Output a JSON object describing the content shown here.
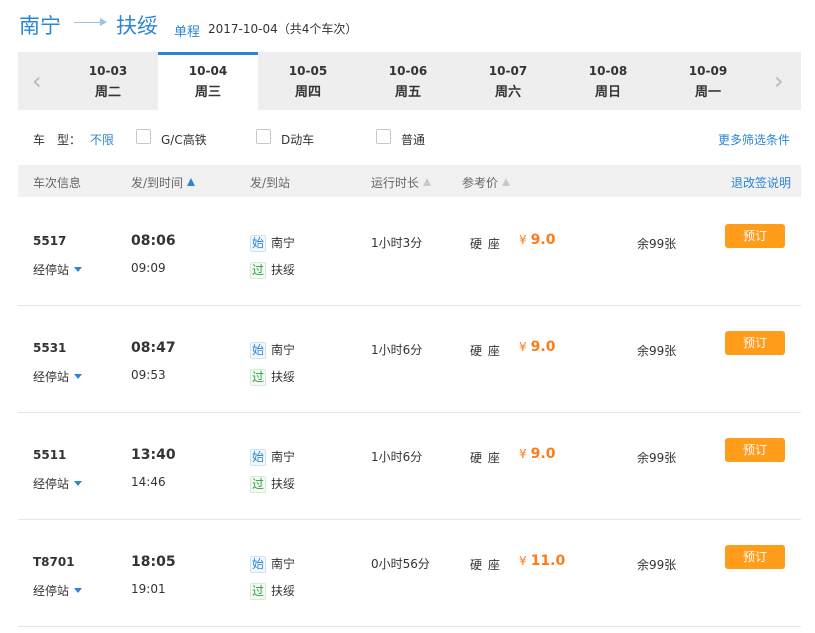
{
  "header": {
    "from_city": "南宁",
    "to_city": "扶绥",
    "trip_type": "单程",
    "trip_info": "2017-10-04（共4个车次）"
  },
  "dates": [
    {
      "date": "10-03",
      "weekday": "周二"
    },
    {
      "date": "10-04",
      "weekday": "周三",
      "active": true
    },
    {
      "date": "10-05",
      "weekday": "周四"
    },
    {
      "date": "10-06",
      "weekday": "周五"
    },
    {
      "date": "10-07",
      "weekday": "周六"
    },
    {
      "date": "10-08",
      "weekday": "周日"
    },
    {
      "date": "10-09",
      "weekday": "周一"
    }
  ],
  "date_nav": {
    "prev_icon": "chevron-left-icon",
    "next_icon": "chevron-right-icon"
  },
  "filter": {
    "label": "车　型：",
    "no_limit": "不限",
    "options": [
      "G/C高铁",
      "D动车",
      "普通"
    ],
    "more": "更多筛选条件"
  },
  "table_header": {
    "train_info": "车次信息",
    "dep_arr_time": "发/到时间",
    "dep_arr_station": "发/到站",
    "duration": "运行时长",
    "price": "参考价",
    "refund_note": "退改签说明"
  },
  "trains": [
    {
      "no": "5517",
      "stops_label": "经停站",
      "dep": "08:06",
      "arr": "09:09",
      "start_tag": "始",
      "from": "南宁",
      "pass_tag": "过",
      "to": "扶绥",
      "duration": "1小时3分",
      "seat": "硬 座",
      "currency": "¥",
      "price": "9.0",
      "remain": "余99张",
      "book": "预订"
    },
    {
      "no": "5531",
      "stops_label": "经停站",
      "dep": "08:47",
      "arr": "09:53",
      "start_tag": "始",
      "from": "南宁",
      "pass_tag": "过",
      "to": "扶绥",
      "duration": "1小时6分",
      "seat": "硬 座",
      "currency": "¥",
      "price": "9.0",
      "remain": "余99张",
      "book": "预订"
    },
    {
      "no": "5511",
      "stops_label": "经停站",
      "dep": "13:40",
      "arr": "14:46",
      "start_tag": "始",
      "from": "南宁",
      "pass_tag": "过",
      "to": "扶绥",
      "duration": "1小时6分",
      "seat": "硬 座",
      "currency": "¥",
      "price": "9.0",
      "remain": "余99张",
      "book": "预订"
    },
    {
      "no": "T8701",
      "stops_label": "经停站",
      "dep": "18:05",
      "arr": "19:01",
      "start_tag": "始",
      "from": "南宁",
      "pass_tag": "过",
      "to": "扶绥",
      "duration": "0小时56分",
      "seat": "硬 座",
      "currency": "¥",
      "price": "11.0",
      "remain": "余99张",
      "book": "预订"
    }
  ],
  "colors": {
    "accent": "#2b86d6",
    "price": "#ff7a1a",
    "book_button": "#ff9c1a"
  }
}
